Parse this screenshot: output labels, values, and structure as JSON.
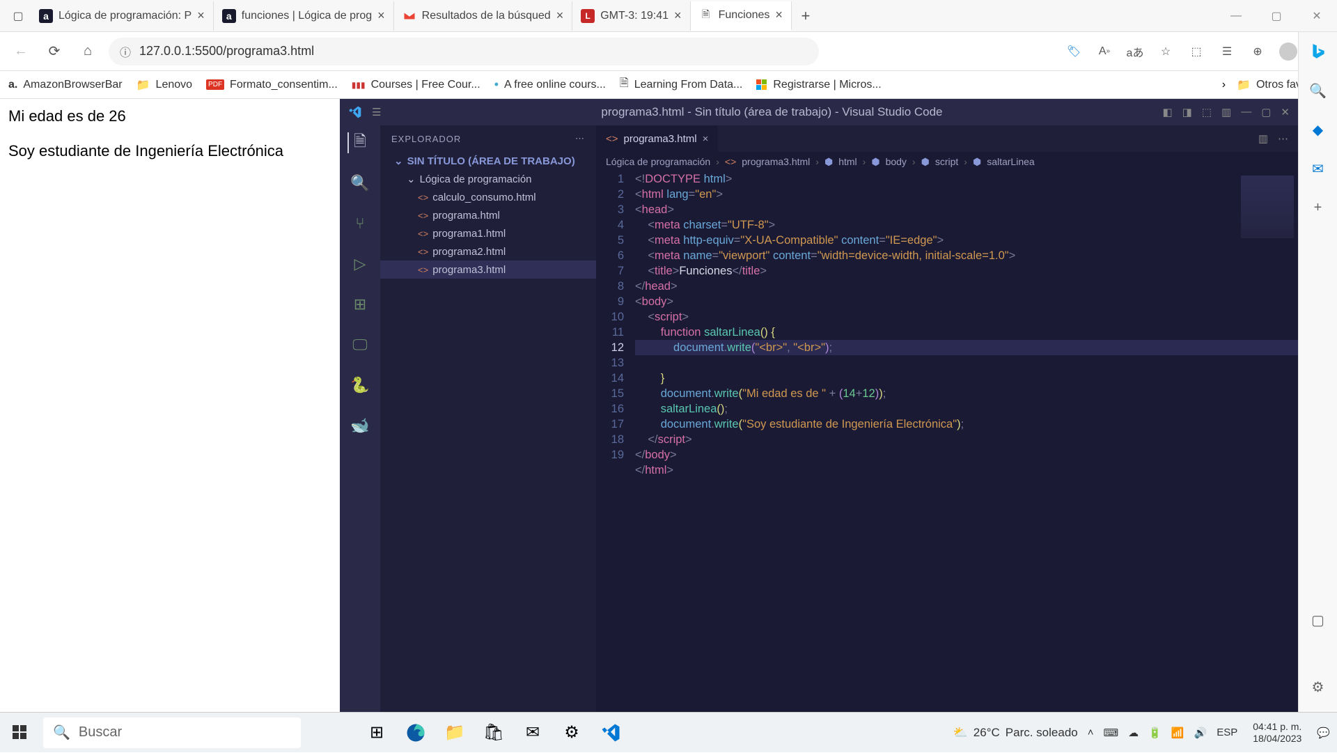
{
  "browser": {
    "tabs": [
      {
        "title": "Lógica de programación: P",
        "icon": "a"
      },
      {
        "title": "funciones | Lógica de prog",
        "icon": "a"
      },
      {
        "title": "Resultados de la búsqued",
        "icon": "M"
      },
      {
        "title": "GMT-3: 19:41",
        "icon": "L"
      },
      {
        "title": "Funciones",
        "icon": "doc",
        "active": true
      }
    ],
    "url": "127.0.0.1:5500/programa3.html",
    "bookmarks": [
      {
        "label": "AmazonBrowserBar",
        "icon": "a"
      },
      {
        "label": "Lenovo",
        "icon": "folder"
      },
      {
        "label": "Formato_consentim...",
        "icon": "pdf"
      },
      {
        "label": "Courses | Free Cour...",
        "icon": "cc"
      },
      {
        "label": "A free online cours...",
        "icon": "dot"
      },
      {
        "label": "Learning From Data...",
        "icon": "doc"
      },
      {
        "label": "Registrarse | Micros...",
        "icon": "ms"
      }
    ],
    "other_favorites": "Otros favoritos"
  },
  "page": {
    "line1": "Mi edad es de 26",
    "line2": "Soy estudiante de Ingeniería Electrónica"
  },
  "vscode": {
    "title": "programa3.html - Sin título (área de trabajo) - Visual Studio Code",
    "explorer_label": "EXPLORADOR",
    "workspace_label": "SIN TÍTULO (ÁREA DE TRABAJO)",
    "folder": "Lógica de programación",
    "files": [
      "calculo_consumo.html",
      "programa.html",
      "programa1.html",
      "programa2.html",
      "programa3.html"
    ],
    "active_file": "programa3.html",
    "breadcrumb": [
      "Lógica de programación",
      "programa3.html",
      "html",
      "body",
      "script",
      "saltarLinea"
    ],
    "line_numbers": [
      "1",
      "2",
      "3",
      "4",
      "5",
      "6",
      "7",
      "8",
      "9",
      "10",
      "11",
      "12",
      "13",
      "14",
      "15",
      "16",
      "17",
      "18",
      "19"
    ],
    "current_line": 12
  },
  "taskbar": {
    "search_placeholder": "Buscar",
    "weather_temp": "26°C",
    "weather_desc": "Parc. soleado",
    "lang": "ESP",
    "time": "04:41 p. m.",
    "date": "18/04/2023"
  }
}
